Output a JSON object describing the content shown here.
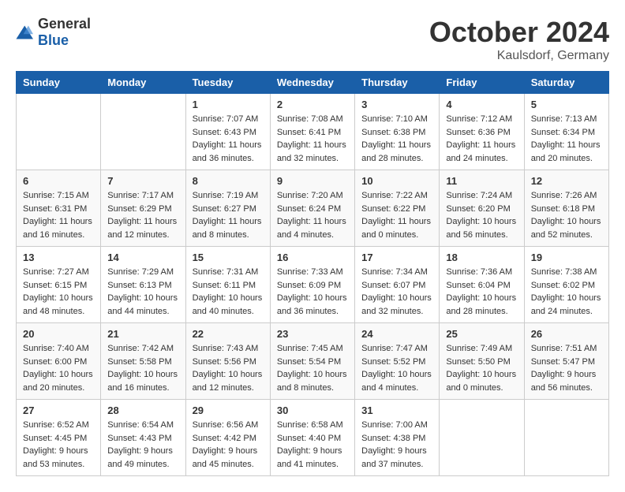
{
  "logo": {
    "general": "General",
    "blue": "Blue"
  },
  "title": {
    "month": "October 2024",
    "location": "Kaulsdorf, Germany"
  },
  "weekdays": [
    "Sunday",
    "Monday",
    "Tuesday",
    "Wednesday",
    "Thursday",
    "Friday",
    "Saturday"
  ],
  "weeks": [
    [
      {
        "day": "",
        "info": ""
      },
      {
        "day": "",
        "info": ""
      },
      {
        "day": "1",
        "sunrise": "Sunrise: 7:07 AM",
        "sunset": "Sunset: 6:43 PM",
        "daylight": "Daylight: 11 hours and 36 minutes."
      },
      {
        "day": "2",
        "sunrise": "Sunrise: 7:08 AM",
        "sunset": "Sunset: 6:41 PM",
        "daylight": "Daylight: 11 hours and 32 minutes."
      },
      {
        "day": "3",
        "sunrise": "Sunrise: 7:10 AM",
        "sunset": "Sunset: 6:38 PM",
        "daylight": "Daylight: 11 hours and 28 minutes."
      },
      {
        "day": "4",
        "sunrise": "Sunrise: 7:12 AM",
        "sunset": "Sunset: 6:36 PM",
        "daylight": "Daylight: 11 hours and 24 minutes."
      },
      {
        "day": "5",
        "sunrise": "Sunrise: 7:13 AM",
        "sunset": "Sunset: 6:34 PM",
        "daylight": "Daylight: 11 hours and 20 minutes."
      }
    ],
    [
      {
        "day": "6",
        "sunrise": "Sunrise: 7:15 AM",
        "sunset": "Sunset: 6:31 PM",
        "daylight": "Daylight: 11 hours and 16 minutes."
      },
      {
        "day": "7",
        "sunrise": "Sunrise: 7:17 AM",
        "sunset": "Sunset: 6:29 PM",
        "daylight": "Daylight: 11 hours and 12 minutes."
      },
      {
        "day": "8",
        "sunrise": "Sunrise: 7:19 AM",
        "sunset": "Sunset: 6:27 PM",
        "daylight": "Daylight: 11 hours and 8 minutes."
      },
      {
        "day": "9",
        "sunrise": "Sunrise: 7:20 AM",
        "sunset": "Sunset: 6:24 PM",
        "daylight": "Daylight: 11 hours and 4 minutes."
      },
      {
        "day": "10",
        "sunrise": "Sunrise: 7:22 AM",
        "sunset": "Sunset: 6:22 PM",
        "daylight": "Daylight: 11 hours and 0 minutes."
      },
      {
        "day": "11",
        "sunrise": "Sunrise: 7:24 AM",
        "sunset": "Sunset: 6:20 PM",
        "daylight": "Daylight: 10 hours and 56 minutes."
      },
      {
        "day": "12",
        "sunrise": "Sunrise: 7:26 AM",
        "sunset": "Sunset: 6:18 PM",
        "daylight": "Daylight: 10 hours and 52 minutes."
      }
    ],
    [
      {
        "day": "13",
        "sunrise": "Sunrise: 7:27 AM",
        "sunset": "Sunset: 6:15 PM",
        "daylight": "Daylight: 10 hours and 48 minutes."
      },
      {
        "day": "14",
        "sunrise": "Sunrise: 7:29 AM",
        "sunset": "Sunset: 6:13 PM",
        "daylight": "Daylight: 10 hours and 44 minutes."
      },
      {
        "day": "15",
        "sunrise": "Sunrise: 7:31 AM",
        "sunset": "Sunset: 6:11 PM",
        "daylight": "Daylight: 10 hours and 40 minutes."
      },
      {
        "day": "16",
        "sunrise": "Sunrise: 7:33 AM",
        "sunset": "Sunset: 6:09 PM",
        "daylight": "Daylight: 10 hours and 36 minutes."
      },
      {
        "day": "17",
        "sunrise": "Sunrise: 7:34 AM",
        "sunset": "Sunset: 6:07 PM",
        "daylight": "Daylight: 10 hours and 32 minutes."
      },
      {
        "day": "18",
        "sunrise": "Sunrise: 7:36 AM",
        "sunset": "Sunset: 6:04 PM",
        "daylight": "Daylight: 10 hours and 28 minutes."
      },
      {
        "day": "19",
        "sunrise": "Sunrise: 7:38 AM",
        "sunset": "Sunset: 6:02 PM",
        "daylight": "Daylight: 10 hours and 24 minutes."
      }
    ],
    [
      {
        "day": "20",
        "sunrise": "Sunrise: 7:40 AM",
        "sunset": "Sunset: 6:00 PM",
        "daylight": "Daylight: 10 hours and 20 minutes."
      },
      {
        "day": "21",
        "sunrise": "Sunrise: 7:42 AM",
        "sunset": "Sunset: 5:58 PM",
        "daylight": "Daylight: 10 hours and 16 minutes."
      },
      {
        "day": "22",
        "sunrise": "Sunrise: 7:43 AM",
        "sunset": "Sunset: 5:56 PM",
        "daylight": "Daylight: 10 hours and 12 minutes."
      },
      {
        "day": "23",
        "sunrise": "Sunrise: 7:45 AM",
        "sunset": "Sunset: 5:54 PM",
        "daylight": "Daylight: 10 hours and 8 minutes."
      },
      {
        "day": "24",
        "sunrise": "Sunrise: 7:47 AM",
        "sunset": "Sunset: 5:52 PM",
        "daylight": "Daylight: 10 hours and 4 minutes."
      },
      {
        "day": "25",
        "sunrise": "Sunrise: 7:49 AM",
        "sunset": "Sunset: 5:50 PM",
        "daylight": "Daylight: 10 hours and 0 minutes."
      },
      {
        "day": "26",
        "sunrise": "Sunrise: 7:51 AM",
        "sunset": "Sunset: 5:47 PM",
        "daylight": "Daylight: 9 hours and 56 minutes."
      }
    ],
    [
      {
        "day": "27",
        "sunrise": "Sunrise: 6:52 AM",
        "sunset": "Sunset: 4:45 PM",
        "daylight": "Daylight: 9 hours and 53 minutes."
      },
      {
        "day": "28",
        "sunrise": "Sunrise: 6:54 AM",
        "sunset": "Sunset: 4:43 PM",
        "daylight": "Daylight: 9 hours and 49 minutes."
      },
      {
        "day": "29",
        "sunrise": "Sunrise: 6:56 AM",
        "sunset": "Sunset: 4:42 PM",
        "daylight": "Daylight: 9 hours and 45 minutes."
      },
      {
        "day": "30",
        "sunrise": "Sunrise: 6:58 AM",
        "sunset": "Sunset: 4:40 PM",
        "daylight": "Daylight: 9 hours and 41 minutes."
      },
      {
        "day": "31",
        "sunrise": "Sunrise: 7:00 AM",
        "sunset": "Sunset: 4:38 PM",
        "daylight": "Daylight: 9 hours and 37 minutes."
      },
      {
        "day": "",
        "info": ""
      },
      {
        "day": "",
        "info": ""
      }
    ]
  ]
}
